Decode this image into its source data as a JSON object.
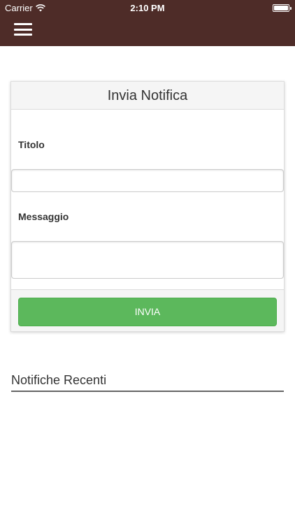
{
  "status_bar": {
    "carrier": "Carrier",
    "time": "2:10 PM",
    "battery_level": 1.0
  },
  "header": {
    "menu_icon": "hamburger-menu-icon",
    "background_color": "#4e2c28"
  },
  "form": {
    "title": "Invia Notifica",
    "title_label": "Titolo",
    "title_value": "",
    "message_label": "Messaggio",
    "message_value": "",
    "send_label": "INVIA",
    "send_color": "#5cb85c"
  },
  "recent": {
    "title": "Notifiche Recenti"
  }
}
